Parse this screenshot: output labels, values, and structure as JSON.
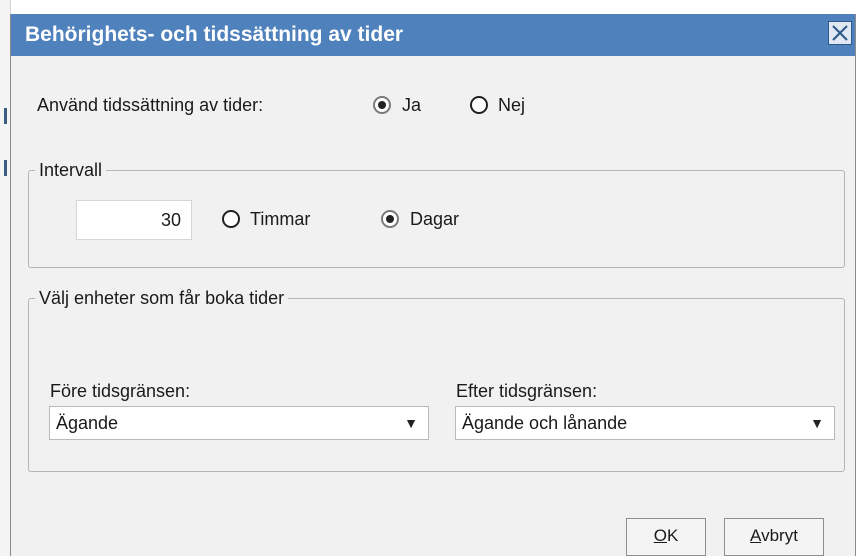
{
  "dialog": {
    "title": "Behörighets- och tidssättning av tider",
    "close_icon": "close-icon"
  },
  "use_timing": {
    "label": "Använd tidssättning  av tider:",
    "options": [
      "Ja",
      "Nej"
    ],
    "selected": "Ja"
  },
  "interval": {
    "legend": "Intervall",
    "value": "30",
    "options": [
      "Timmar",
      "Dagar"
    ],
    "selected": "Dagar"
  },
  "units": {
    "legend": "Välj enheter som får boka tider",
    "before_label": "Före tidsgränsen:",
    "before_value": "Ägande",
    "after_label": "Efter tidsgränsen:",
    "after_value": "Ägande och lånande",
    "dropdown_icon": "chevron-down-icon"
  },
  "buttons": {
    "ok_mnemonic": "O",
    "ok_rest": "K",
    "cancel_mnemonic": "A",
    "cancel_rest": "vbryt"
  },
  "colors": {
    "titlebar": "#4f81bd",
    "dialog_bg": "#f1f1f1"
  }
}
